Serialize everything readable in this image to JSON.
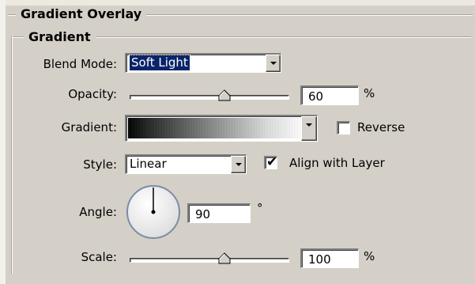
{
  "panel": {
    "outer_title": "Gradient Overlay",
    "inner_title": "Gradient"
  },
  "blend_mode": {
    "label": "Blend Mode:",
    "selected": "Soft Light"
  },
  "opacity": {
    "label": "Opacity:",
    "value": "60",
    "unit": "%",
    "level": 0.6
  },
  "gradient": {
    "label": "Gradient:",
    "stops": [
      "#000000",
      "#ffffff"
    ]
  },
  "reverse": {
    "label": "Reverse",
    "checked": false
  },
  "style": {
    "label": "Style:",
    "selected": "Linear"
  },
  "align_with_layer": {
    "label": "Align with Layer",
    "checked": true
  },
  "angle": {
    "label": "Angle:",
    "value": "90",
    "unit": "°",
    "degrees": 90
  },
  "scale": {
    "label": "Scale:",
    "value": "100",
    "unit": "%",
    "level": 0.6
  },
  "icons": {
    "dropdown": "chevron-down-icon",
    "slider_thumb": "triangle-up-icon",
    "check": "checkmark-icon"
  },
  "colors": {
    "panel_bg": "#d4d0c8",
    "selection": "#0a246a"
  }
}
